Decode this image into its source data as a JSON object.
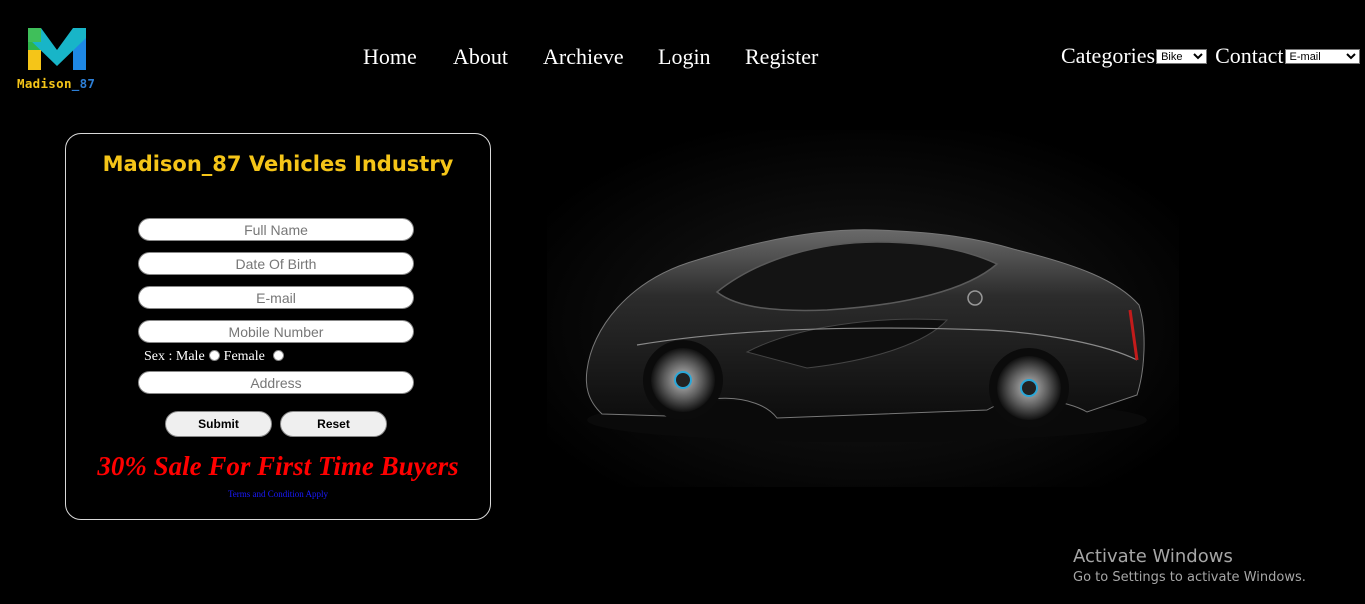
{
  "logo": {
    "text_part1": "Madison",
    "text_part2": "_87"
  },
  "nav": {
    "items": [
      "Home",
      "About",
      "Archieve",
      "Login",
      "Register"
    ]
  },
  "categories": {
    "label": "Categories",
    "selected": "Bike"
  },
  "contact": {
    "label": "Contact",
    "selected": "E-mail"
  },
  "form": {
    "title": "Madison_87 Vehicles Industry",
    "full_name_placeholder": "Full Name",
    "dob_placeholder": "Date Of Birth",
    "email_placeholder": "E-mail",
    "mobile_placeholder": "Mobile Number",
    "sex_label": "Sex : Male",
    "female_label": "Female",
    "address_placeholder": "Address",
    "submit_label": "Submit",
    "reset_label": "Reset",
    "sale_text": "30% Sale For First Time Buyers",
    "terms_text": "Terms and Condition Apply"
  },
  "colors": {
    "accent": "#f5c518",
    "sale": "#ff0000",
    "terms": "#1a1aff"
  },
  "overlay": {
    "activate_title": "Activate Windows",
    "activate_sub": "Go to Settings to activate Windows."
  }
}
